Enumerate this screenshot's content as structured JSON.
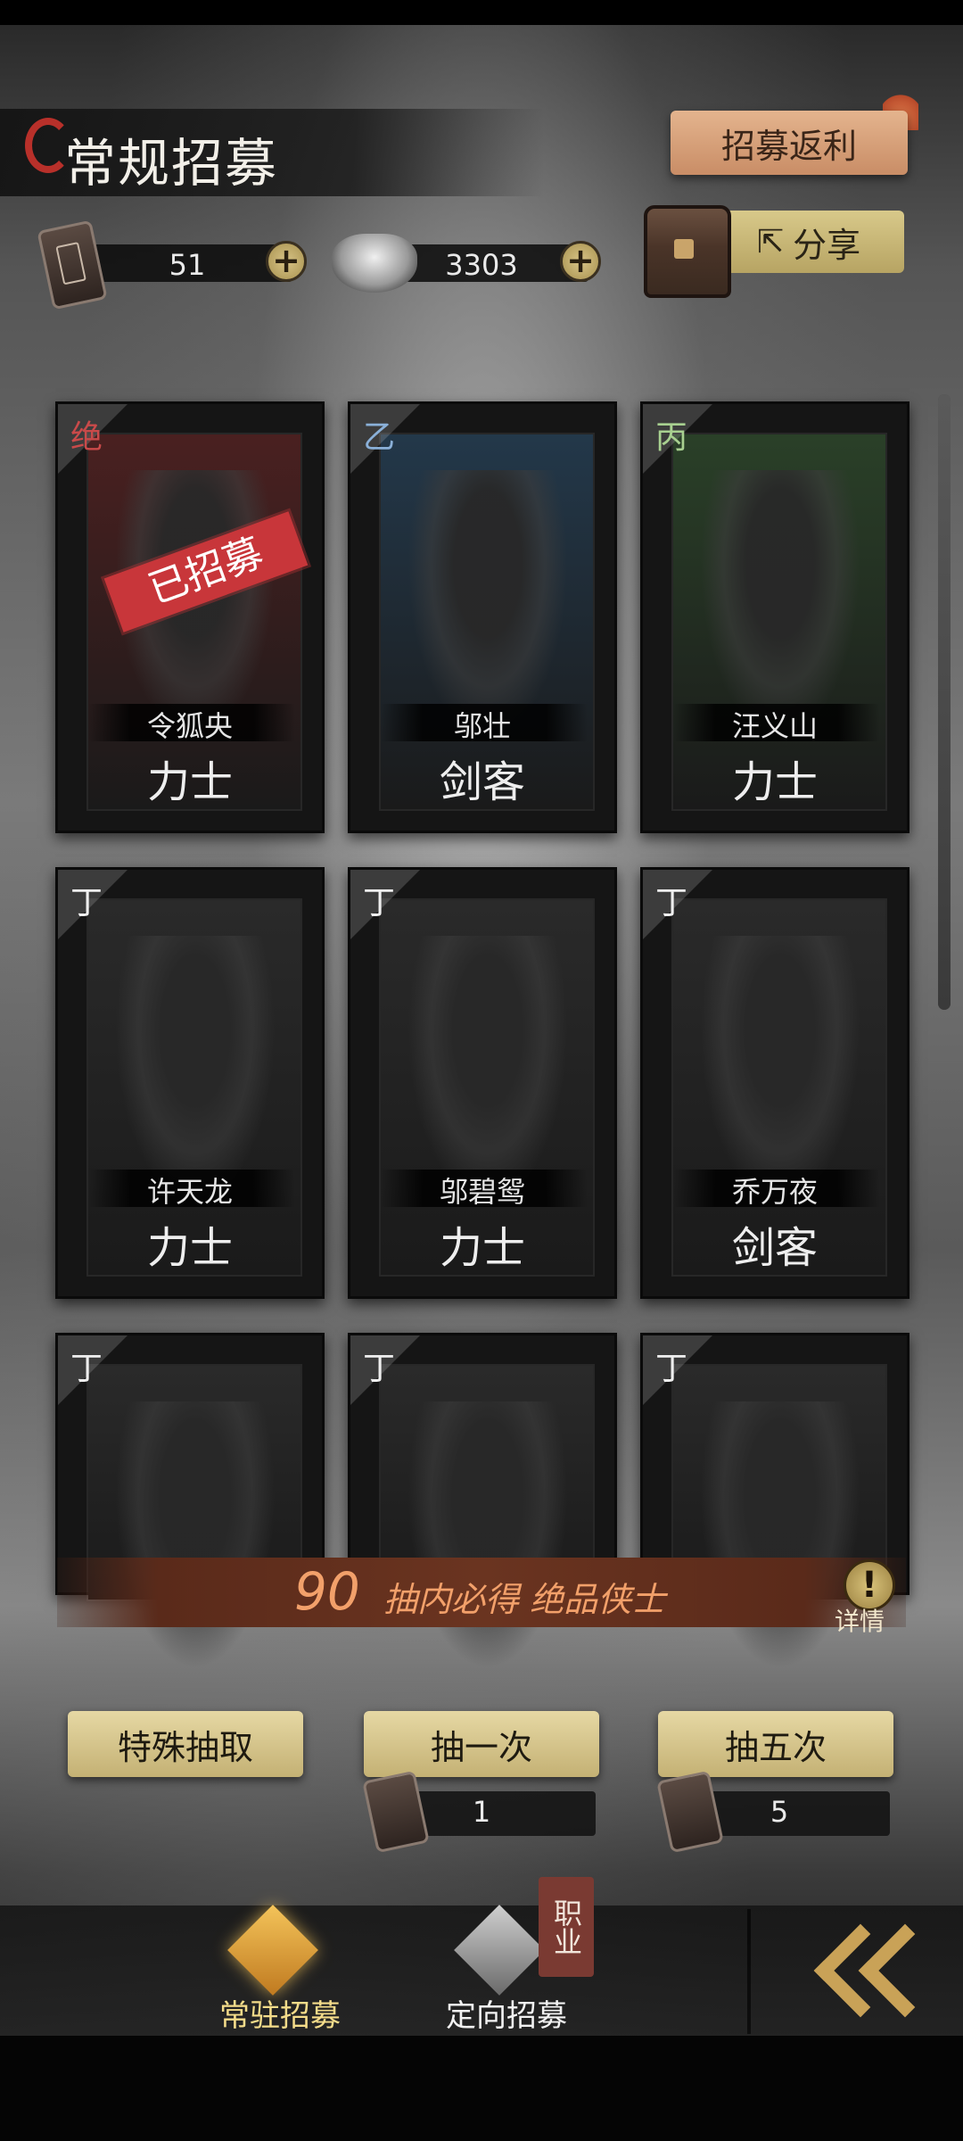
{
  "header": {
    "title": "常规招募",
    "rebate_button": "招募返利",
    "share_button": "分享",
    "share_icon": "share-icon"
  },
  "currency": {
    "tokens": "51",
    "silver": "3303"
  },
  "cards": [
    {
      "rank": "绝",
      "name": "令狐央",
      "class": "力士",
      "recruited": true,
      "stamp": "已招募",
      "tint": "#4a2020",
      "rank_color": "#c94a4a"
    },
    {
      "rank": "乙",
      "name": "邬壮",
      "class": "剑客",
      "recruited": false,
      "tint": "#23384a",
      "rank_color": "#8ab0d8"
    },
    {
      "rank": "丙",
      "name": "汪义山",
      "class": "力士",
      "recruited": false,
      "tint": "#2a4028",
      "rank_color": "#a8d090"
    },
    {
      "rank": "丁",
      "name": "许天龙",
      "class": "力士",
      "recruited": false,
      "tint": "#2a2a2a",
      "rank_color": "#eeeeee"
    },
    {
      "rank": "丁",
      "name": "邬碧鸳",
      "class": "力士",
      "recruited": false,
      "tint": "#2a2a2a",
      "rank_color": "#eeeeee"
    },
    {
      "rank": "丁",
      "name": "乔万夜",
      "class": "剑客",
      "recruited": false,
      "tint": "#2a2a2a",
      "rank_color": "#eeeeee"
    },
    {
      "rank": "丁",
      "name": "",
      "class": "",
      "recruited": false,
      "tint": "#2a2a2a",
      "rank_color": "#eeeeee"
    },
    {
      "rank": "丁",
      "name": "",
      "class": "",
      "recruited": false,
      "tint": "#2a2a2a",
      "rank_color": "#eeeeee"
    },
    {
      "rank": "丁",
      "name": "",
      "class": "",
      "recruited": false,
      "tint": "#2a2a2a",
      "rank_color": "#eeeeee"
    }
  ],
  "pity": {
    "count": "90",
    "text": "抽内必得  绝品侠士",
    "detail_label": "详情"
  },
  "actions": {
    "special": "特殊抽取",
    "single": "抽一次",
    "five": "抽五次",
    "single_cost": "1",
    "five_cost": "5"
  },
  "nav": {
    "regular": "常驻招募",
    "targeted": "定向招募",
    "badge": "职业"
  }
}
